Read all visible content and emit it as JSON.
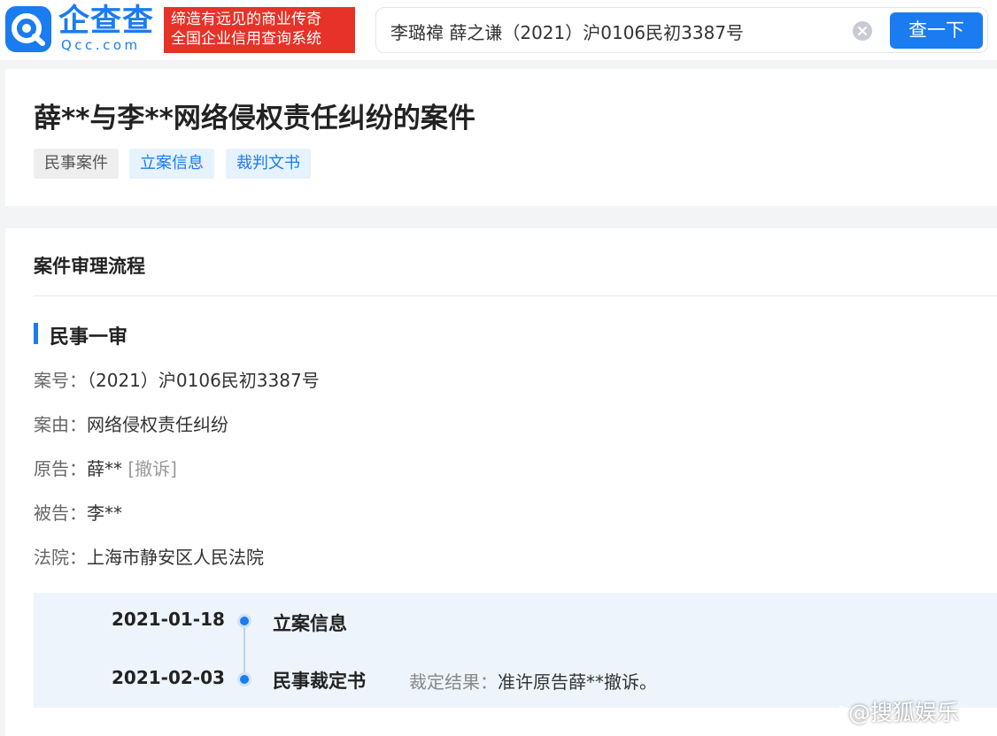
{
  "header": {
    "logo_cn": "企查查",
    "logo_en": "Qcc.com",
    "slogan_line1": "缔造有远见的商业传奇",
    "slogan_line2": "全国企业信用查询系统",
    "search_value": "李璐禕 薛之谦（2021）沪0106民初3387号",
    "search_button": "查一下",
    "brand_color": "#1a7cf0",
    "slogan_color": "#e63228"
  },
  "case": {
    "title": "薛**与李**网络侵权责任纠纷的案件",
    "tags": [
      "民事案件",
      "立案信息",
      "裁判文书"
    ]
  },
  "process": {
    "section_title": "案件审理流程",
    "stage_title": "民事一审",
    "fields": [
      {
        "label": "案号：",
        "value": "（2021）沪0106民初3387号",
        "note": ""
      },
      {
        "label": "案由：",
        "value": "网络侵权责任纠纷",
        "note": ""
      },
      {
        "label": "原告：",
        "value": "薛** ",
        "note": "[撤诉]"
      },
      {
        "label": "被告：",
        "value": "李**",
        "note": ""
      },
      {
        "label": "法院：",
        "value": "上海市静安区人民法院",
        "note": ""
      }
    ],
    "timeline": [
      {
        "date": "2021-01-18",
        "event": "立案信息",
        "result_label": "",
        "result_value": ""
      },
      {
        "date": "2021-02-03",
        "event": "民事裁定书",
        "result_label": "裁定结果：",
        "result_value": "准许原告薛**撤诉。"
      }
    ]
  },
  "watermark": {
    "text": "@搜狐娱乐"
  }
}
